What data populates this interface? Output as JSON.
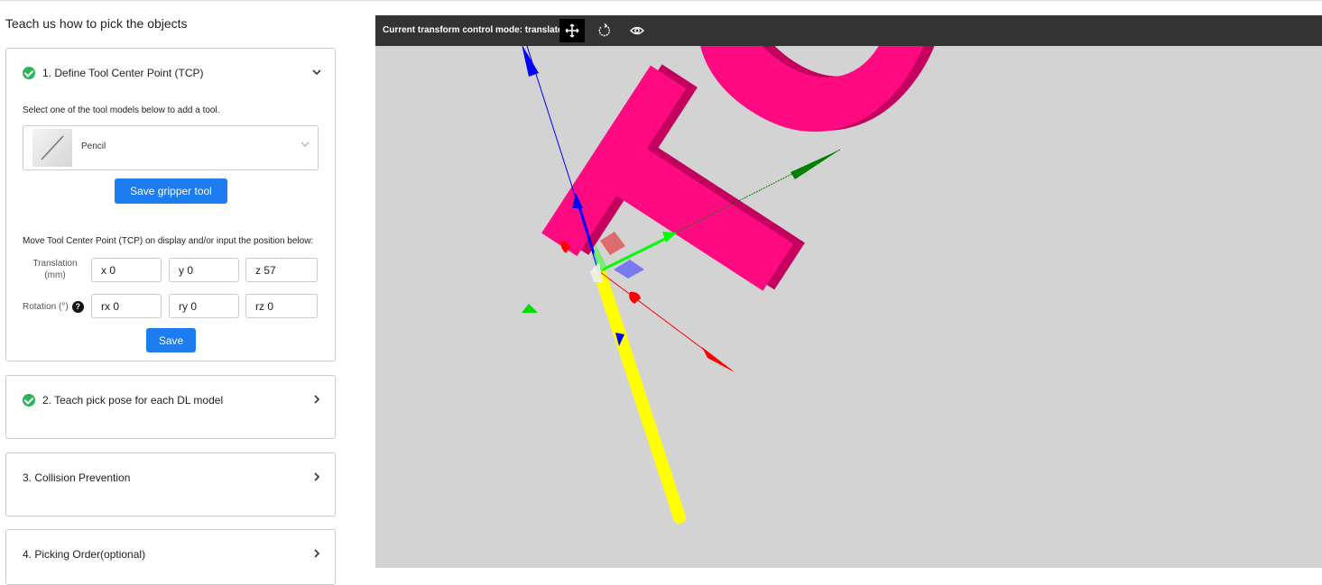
{
  "page_title": "Teach us how to pick the objects",
  "steps": [
    {
      "label": "1. Define Tool Center Point (TCP)",
      "done": true
    },
    {
      "label": "2. Teach pick pose for each DL model",
      "done": true
    },
    {
      "label": "3. Collision Prevention",
      "done": false
    },
    {
      "label": "4. Picking Order(optional)",
      "done": false
    }
  ],
  "tcp": {
    "select_hint": "Select one of the tool models below to add a tool.",
    "tool_name": "Pencil",
    "save_gripper_label": "Save gripper tool",
    "move_hint": "Move Tool Center Point (TCP) on display and/or input the position below:",
    "translation_label": "Translation",
    "translation_unit": "(mm)",
    "rotation_label": "Rotation (°)",
    "x": "x 0",
    "y": "y 0",
    "z": "z 57",
    "rx": "rx 0",
    "ry": "ry 0",
    "rz": "rz 0",
    "save_label": "Save"
  },
  "viewer": {
    "mode_text": "Current transform control mode: translate",
    "icons": [
      "translate-icon",
      "rotate-icon",
      "eye-icon"
    ],
    "scene_text": "TCP",
    "colors": {
      "text": "#ff0a80",
      "tool": "#ffff00",
      "x_axis": "#ff0000",
      "y_axis": "#00cc00",
      "z_axis": "#0000ff",
      "background": "#d3d3d3"
    }
  }
}
